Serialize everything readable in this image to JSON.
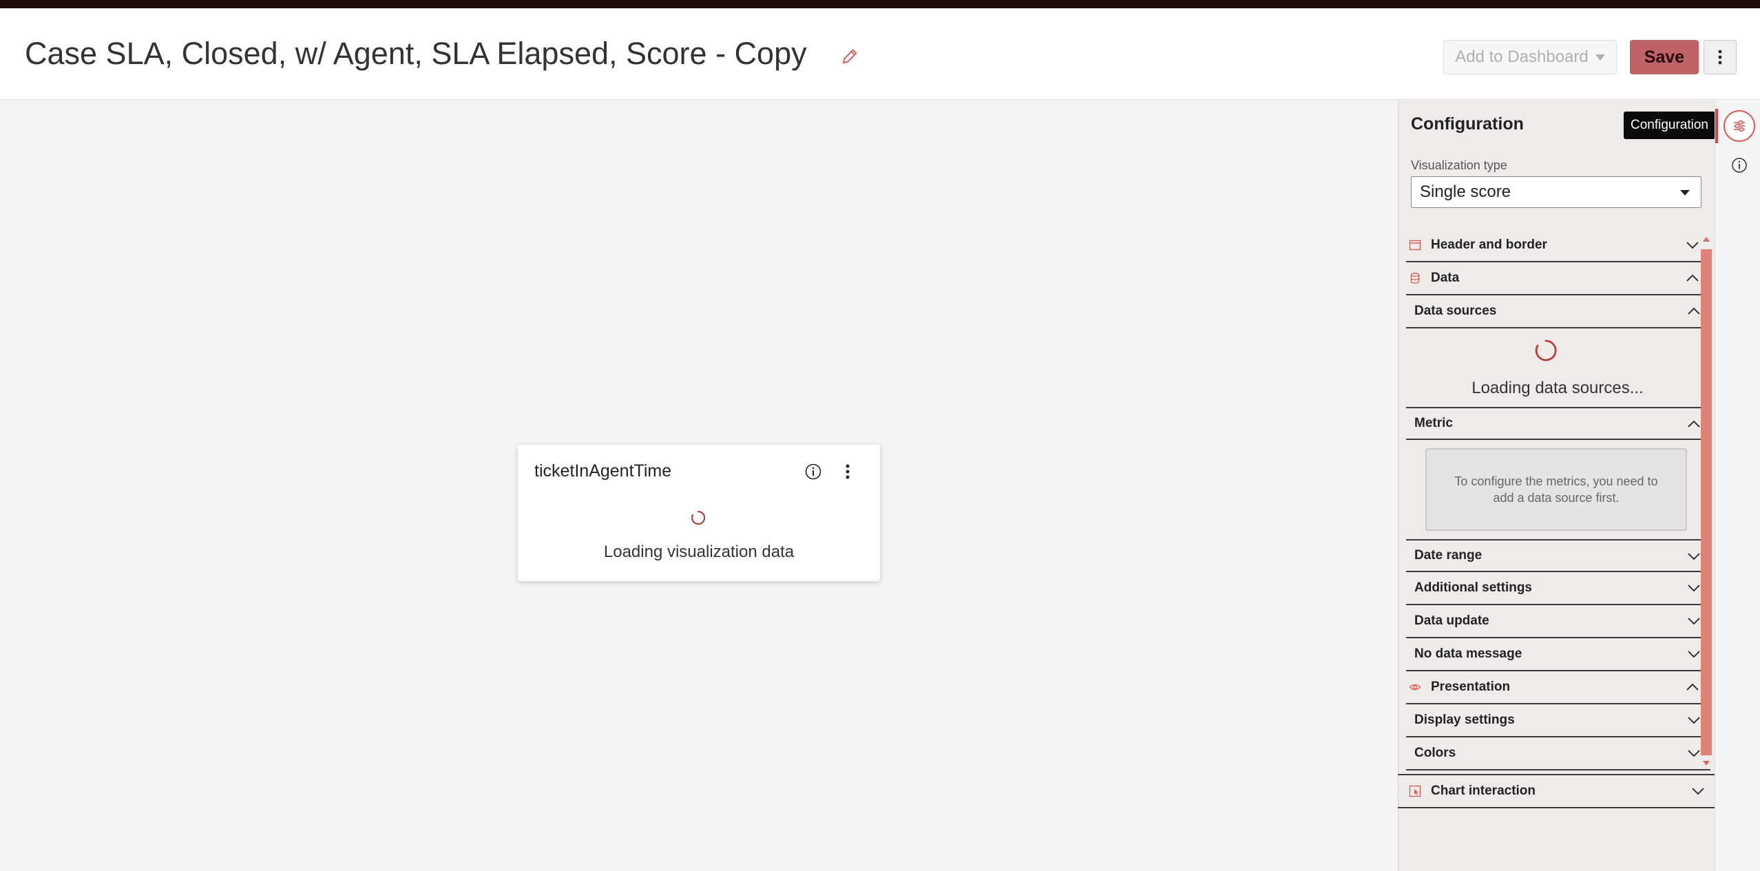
{
  "header": {
    "title": "Case SLA, Closed, w/ Agent, SLA Elapsed, Score - Copy",
    "add_to_dashboard_label": "Add to Dashboard",
    "save_label": "Save"
  },
  "widget": {
    "title": "ticketInAgentTime",
    "loading_text": "Loading visualization data"
  },
  "config_panel": {
    "title": "Configuration",
    "tooltip": "Configuration",
    "viz_type_label": "Visualization type",
    "viz_type_value": "Single score",
    "sections": {
      "header_border": "Header and border",
      "data": "Data",
      "data_sources": "Data sources",
      "data_sources_loading": "Loading data sources...",
      "metric": "Metric",
      "metric_hint": "To configure the metrics, you need to add a data source first.",
      "date_range": "Date range",
      "additional_settings": "Additional settings",
      "data_update": "Data update",
      "no_data_message": "No data message",
      "presentation": "Presentation",
      "display_settings": "Display settings",
      "colors": "Colors",
      "chart_interaction": "Chart interaction"
    }
  },
  "icons": {
    "edit": "pencil-icon",
    "info": "info-icon",
    "kebab": "more-vertical-icon",
    "config": "sliders-icon",
    "header_border": "window-icon",
    "data": "database-icon",
    "presentation": "eye-icon",
    "chart_interaction": "pointer-icon"
  },
  "colors": {
    "accent": "#d95a52",
    "save_button": "#bf6466",
    "scrollbar": "#e18077"
  }
}
